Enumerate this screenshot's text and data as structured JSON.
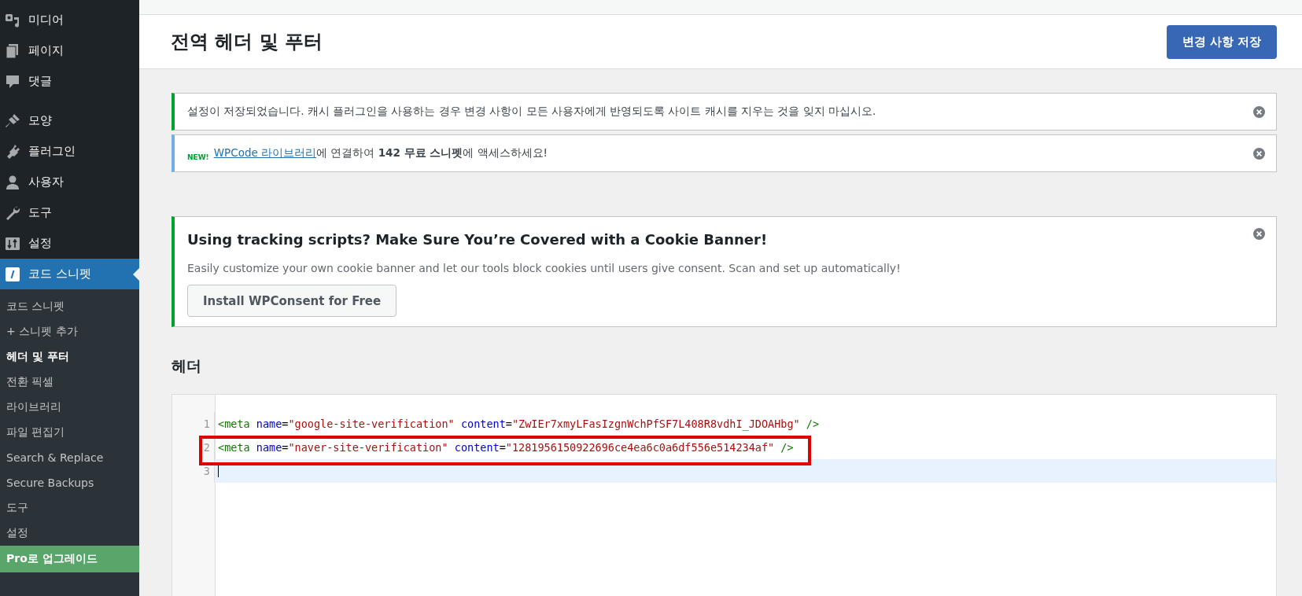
{
  "sidebar": {
    "items": [
      {
        "label": "미디어",
        "selected": false
      },
      {
        "label": "페이지",
        "selected": false
      },
      {
        "label": "댓글",
        "selected": false
      },
      {
        "label": "모양",
        "selected": false
      },
      {
        "label": "플러그인",
        "selected": false
      },
      {
        "label": "사용자",
        "selected": false
      },
      {
        "label": "도구",
        "selected": false
      },
      {
        "label": "설정",
        "selected": false
      },
      {
        "label": "코드 스니펫",
        "selected": true
      }
    ],
    "submenu": [
      {
        "label": "코드 스니펫",
        "selected": false,
        "kind": "link"
      },
      {
        "label": "+ 스니펫 추가",
        "selected": false,
        "kind": "link"
      },
      {
        "label": "헤더 및 푸터",
        "selected": true,
        "kind": "link"
      },
      {
        "label": "전환 픽셀",
        "selected": false,
        "kind": "link"
      },
      {
        "label": "라이브러리",
        "selected": false,
        "kind": "link"
      },
      {
        "label": "파일 편집기",
        "selected": false,
        "kind": "link"
      },
      {
        "label": "Search & Replace",
        "selected": false,
        "kind": "link"
      },
      {
        "label": "Secure Backups",
        "selected": false,
        "kind": "link"
      },
      {
        "label": "도구",
        "selected": false,
        "kind": "link"
      },
      {
        "label": "설정",
        "selected": false,
        "kind": "link"
      },
      {
        "label": "Pro로 업그레이드",
        "selected": false,
        "kind": "upgrade"
      }
    ]
  },
  "header": {
    "title": "전역 헤더 및 푸터",
    "save_button": "변경 사항 저장"
  },
  "notices": [
    {
      "kind": "success",
      "text": "설정이 저장되었습니다. 캐시 플러그인을 사용하는 경우 변경 사항이 모든 사용자에게 반영되도록 사이트 캐시를 지우는 것을 잊지 마십시오."
    },
    {
      "kind": "info",
      "badge": "NEW!",
      "link": "WPCode 라이브러리",
      "text": "에 연결하여 **142 무료 스니펫**에 액세스하세요!"
    }
  ],
  "banner": {
    "title": "Using tracking scripts? Make Sure You’re Covered with a Cookie Banner!",
    "text": "Easily customize your own cookie banner and let our tools block cookies until users give consent. Scan and set up automatically!",
    "button": "Install WPConsent for Free"
  },
  "section_heading": "헤더",
  "editor": {
    "lines": [
      {
        "number": "1",
        "active": false,
        "outlined": false,
        "tokens": [
          {
            "kind": "tag",
            "text": "<meta"
          },
          {
            "kind": "attr",
            "text": " name"
          },
          {
            "kind": "plain",
            "text": "="
          },
          {
            "kind": "str",
            "text": "\"google-site-verification\""
          },
          {
            "kind": "attr",
            "text": " content"
          },
          {
            "kind": "plain",
            "text": "="
          },
          {
            "kind": "str",
            "text": "\"ZwIEr7xmyLFasIzgnWchPfSF7L408R8vdhI_JDOAHbg\""
          },
          {
            "kind": "tag",
            "text": " />"
          }
        ]
      },
      {
        "number": "2",
        "active": false,
        "outlined": true,
        "tokens": [
          {
            "kind": "tag",
            "text": "<meta"
          },
          {
            "kind": "attr",
            "text": " name"
          },
          {
            "kind": "plain",
            "text": "="
          },
          {
            "kind": "str",
            "text": "\"naver-site-verification\""
          },
          {
            "kind": "attr",
            "text": " content"
          },
          {
            "kind": "plain",
            "text": "="
          },
          {
            "kind": "str",
            "text": "\"1281956150922696ce4ea6c0a6df556e514234af\""
          },
          {
            "kind": "tag",
            "text": " />"
          }
        ]
      },
      {
        "number": "3",
        "active": true,
        "outlined": false
      }
    ]
  }
}
